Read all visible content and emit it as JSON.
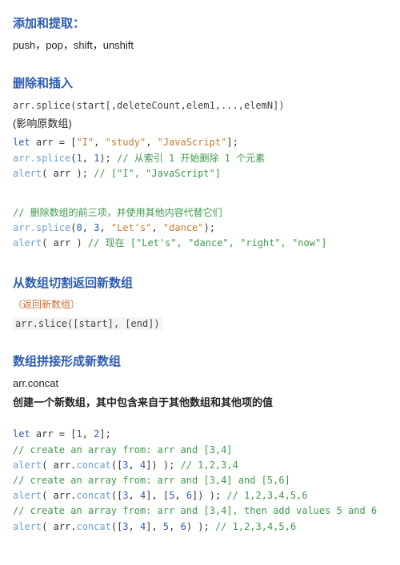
{
  "section1": {
    "heading": "添加和提取：",
    "body": "push，pop，shift，unshift"
  },
  "section2": {
    "heading": "删除和插入",
    "signature": "arr.splice(start[,deleteCount,elem1,...,elemN])",
    "note": "(影响原数组)",
    "code1": {
      "line1_kw": "let",
      "line1_rest": " arr = [",
      "line1_s1": "\"I\"",
      "line1_c1": ", ",
      "line1_s2": "\"study\"",
      "line1_c2": ", ",
      "line1_s3": "\"JavaScript\"",
      "line1_end": "];",
      "line2_a": "arr.",
      "line2_fn": "splice",
      "line2_b": "(",
      "line2_n1": "1",
      "line2_c": ", ",
      "line2_n2": "1",
      "line2_d": "); ",
      "line2_cmt": "// 从索引 1 开始删除 1 个元素",
      "line3_fn": "alert",
      "line3_a": "( arr ); ",
      "line3_cmt": "// [\"I\", \"JavaScript\"]"
    },
    "code2": {
      "line1_cmt": "// 删除数组的前三项，并使用其他内容代替它们",
      "line2_a": "arr.",
      "line2_fn": "splice",
      "line2_b": "(",
      "line2_n1": "0",
      "line2_c": ", ",
      "line2_n2": "3",
      "line2_d": ", ",
      "line2_s1": "\"Let's\"",
      "line2_e": ", ",
      "line2_s2": "\"dance\"",
      "line2_f": ");",
      "line3_fn": "alert",
      "line3_a": "( arr ) ",
      "line3_cmt": "// 现在 [\"Let's\", \"dance\", \"right\", \"now\"]"
    }
  },
  "section3": {
    "heading": "从数组切割返回新数组",
    "note": "（返回新数组）",
    "signature": "arr.slice([start], [end])"
  },
  "section4": {
    "heading": "数组拼接形成新数组",
    "subtitle": "arr.concat",
    "desc": "创建一个新数组，其中包含来自于其他数组和其他项的值",
    "code": {
      "l1_kw": "let",
      "l1_rest": " arr = [",
      "l1_n1": "1",
      "l1_c1": ", ",
      "l1_n2": "2",
      "l1_end": "];",
      "l2_cmt": "// create an array from: arr and [3,4]",
      "l3_fn": "alert",
      "l3_a": "( arr.",
      "l3_fn2": "concat",
      "l3_b": "([",
      "l3_n1": "3",
      "l3_c1": ", ",
      "l3_n2": "4",
      "l3_d": "]) ); ",
      "l3_cmt": "// 1,2,3,4",
      "l4_cmt": "// create an array from: arr and [3,4] and [5,6]",
      "l5_fn": "alert",
      "l5_a": "( arr.",
      "l5_fn2": "concat",
      "l5_b": "([",
      "l5_n1": "3",
      "l5_c1": ", ",
      "l5_n2": "4",
      "l5_d": "], [",
      "l5_n3": "5",
      "l5_c2": ", ",
      "l5_n4": "6",
      "l5_e": "]) ); ",
      "l5_cmt": "// 1,2,3,4,5,6",
      "l6_cmt": "// create an array from: arr and [3,4], then add values 5 and 6",
      "l7_fn": "alert",
      "l7_a": "( arr.",
      "l7_fn2": "concat",
      "l7_b": "([",
      "l7_n1": "3",
      "l7_c1": ", ",
      "l7_n2": "4",
      "l7_d": "], ",
      "l7_n3": "5",
      "l7_e": ", ",
      "l7_n4": "6",
      "l7_f": ") ); ",
      "l7_cmt": "// 1,2,3,4,5,6"
    }
  }
}
